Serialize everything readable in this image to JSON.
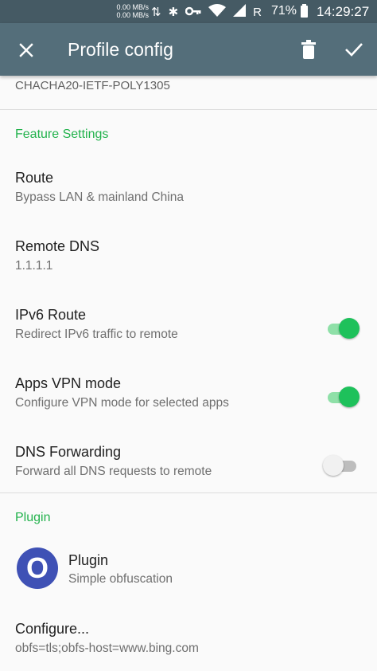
{
  "status_bar": {
    "speed_up": "0.00 MB/s",
    "speed_down": "0.00 MB/s",
    "icons": [
      "data-arrows-icon",
      "bluetooth-icon",
      "vpn-key-icon",
      "wifi-icon",
      "signal-icon",
      "roaming-icon"
    ],
    "roaming": "R",
    "battery": "71%",
    "time": "14:29:27"
  },
  "toolbar": {
    "title": "Profile config",
    "close_icon": "close-icon",
    "delete_icon": "delete-icon",
    "save_icon": "check-icon"
  },
  "partial_value": "CHACHA20-IETF-POLY1305",
  "feature_settings": {
    "section_title": "Feature Settings",
    "route": {
      "title": "Route",
      "summary": "Bypass LAN & mainland China"
    },
    "remote_dns": {
      "title": "Remote DNS",
      "summary": "1.1.1.1"
    },
    "ipv6_route": {
      "title": "IPv6 Route",
      "summary": "Redirect IPv6 traffic to remote",
      "enabled": true
    },
    "apps_vpn": {
      "title": "Apps VPN mode",
      "summary": "Configure VPN mode for selected apps",
      "enabled": true
    },
    "dns_forwarding": {
      "title": "DNS Forwarding",
      "summary": "Forward all DNS requests to remote",
      "enabled": false
    }
  },
  "plugin_section": {
    "section_title": "Plugin",
    "plugin": {
      "icon_letter": "O",
      "title": "Plugin",
      "summary": "Simple obfuscation"
    },
    "configure": {
      "title": "Configure...",
      "summary": "obfs=tls;obfs-host=www.bing.com"
    }
  },
  "colors": {
    "status_bar": "#455a64",
    "toolbar": "#546e7a",
    "accent_green": "#22b24c",
    "switch_on": "#1ec15b",
    "plugin_icon": "#3f51b5"
  }
}
